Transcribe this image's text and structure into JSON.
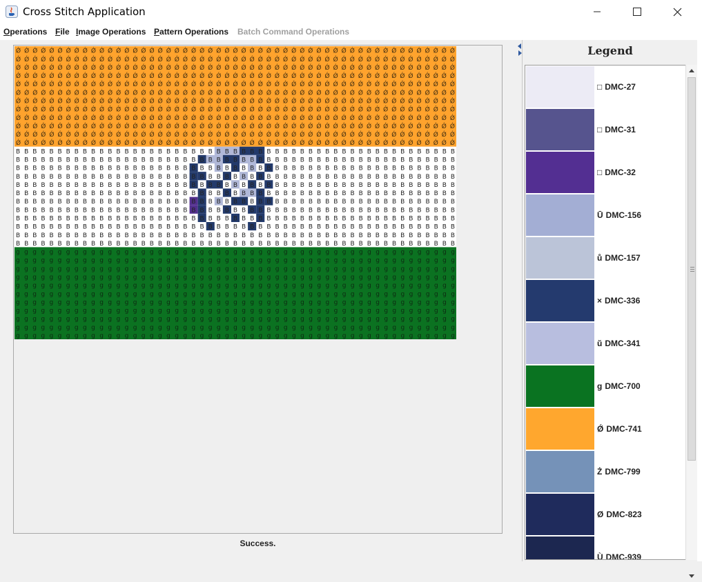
{
  "window": {
    "title": "Cross Stitch Application"
  },
  "menu": [
    {
      "label": "Operations",
      "mnemonic": "O",
      "rest": "perations",
      "enabled": true
    },
    {
      "label": "File",
      "mnemonic": "F",
      "rest": "ile",
      "enabled": true
    },
    {
      "label": "Image Operations",
      "mnemonic": "I",
      "rest": "mage Operations",
      "enabled": true
    },
    {
      "label": "Pattern Operations",
      "mnemonic": "P",
      "rest": "attern Operations",
      "enabled": true
    },
    {
      "label": "Batch Command Operations",
      "mnemonic": "",
      "rest": "Batch Command Operations",
      "enabled": false
    }
  ],
  "status": {
    "message": "Success."
  },
  "legend": {
    "title": "Legend",
    "items": [
      {
        "symbol": "□",
        "code": "DMC-27",
        "color": "#ecebf5"
      },
      {
        "symbol": "□",
        "code": "DMC-31",
        "color": "#56548e"
      },
      {
        "symbol": "□",
        "code": "DMC-32",
        "color": "#532f92"
      },
      {
        "symbol": "Ū",
        "code": "DMC-156",
        "color": "#a3aed4"
      },
      {
        "symbol": "ů",
        "code": "DMC-157",
        "color": "#bbc4d8"
      },
      {
        "symbol": "×",
        "code": "DMC-336",
        "color": "#243a6e"
      },
      {
        "symbol": "ŭ",
        "code": "DMC-341",
        "color": "#b8bedf"
      },
      {
        "symbol": "g",
        "code": "DMC-700",
        "color": "#0a7321"
      },
      {
        "symbol": "Ǿ",
        "code": "DMC-741",
        "color": "#ffa72e"
      },
      {
        "symbol": "Ż",
        "code": "DMC-799",
        "color": "#7592b8"
      },
      {
        "symbol": "Ø",
        "code": "DMC-823",
        "color": "#1f2b5c"
      },
      {
        "symbol": "Ù",
        "code": "DMC-939",
        "color": "#1c2750"
      }
    ]
  },
  "pattern": {
    "stitch_symbols": {
      "saffron": "Ǿ",
      "white": "B",
      "green": "g"
    },
    "colors": {
      "saffron": "#ffa32d",
      "white": "#ffffff",
      "green": "#0b7221",
      "chakra": "#233a6b",
      "chakra_light": "#b0b8d8",
      "chakra_purple": "#53308f"
    }
  }
}
